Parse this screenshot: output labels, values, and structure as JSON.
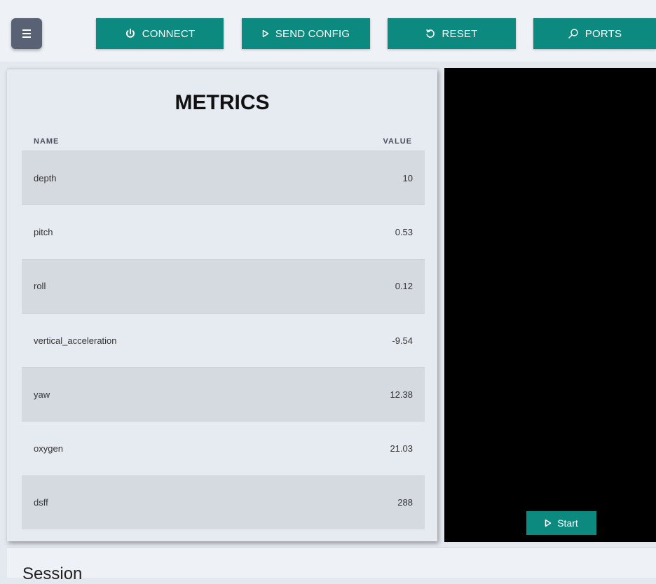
{
  "toolbar": {
    "menu_icon": "hamburger-icon",
    "buttons": [
      {
        "label": "CONNECT",
        "icon": "power-icon"
      },
      {
        "label": "SEND CONFIG",
        "icon": "play-icon"
      },
      {
        "label": "RESET",
        "icon": "refresh-icon"
      },
      {
        "label": "PORTS",
        "icon": "search-icon"
      }
    ]
  },
  "metrics": {
    "title": "METRICS",
    "columns": {
      "name": "NAME",
      "value": "VALUE"
    },
    "rows": [
      {
        "name": "depth",
        "value": "10"
      },
      {
        "name": "pitch",
        "value": "0.53"
      },
      {
        "name": "roll",
        "value": "0.12"
      },
      {
        "name": "vertical_acceleration",
        "value": "-9.54"
      },
      {
        "name": "yaw",
        "value": "12.38"
      },
      {
        "name": "oxygen",
        "value": "21.03"
      },
      {
        "name": "dsff",
        "value": "288"
      }
    ]
  },
  "video": {
    "start_label": "Start",
    "start_icon": "play-icon"
  },
  "session": {
    "title": "Session"
  },
  "colors": {
    "accent": "#0d8a80",
    "menu_button": "#586274",
    "video_background": "#000000"
  }
}
